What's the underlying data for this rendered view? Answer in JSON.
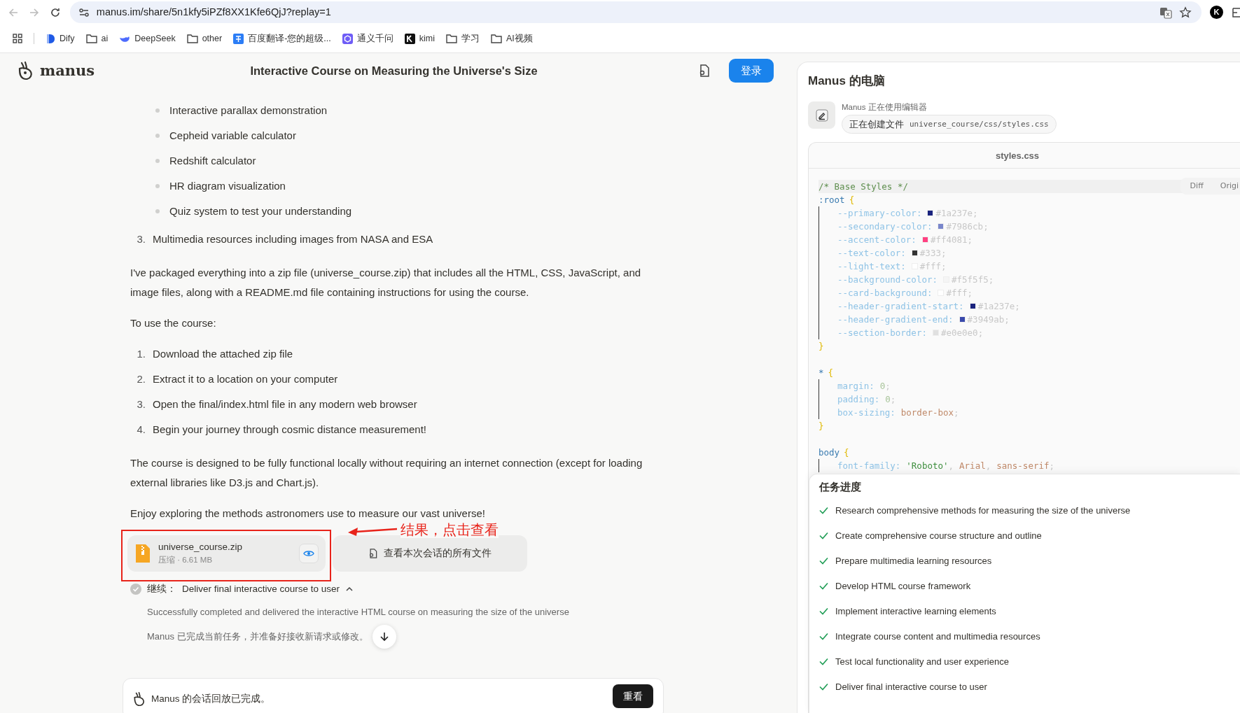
{
  "browser": {
    "url": "manus.im/share/5n1kfy5iPZf8XX1Kfe6QjJ?replay=1",
    "profile": "K",
    "bookmarks": [
      {
        "kind": "dify",
        "label": "Dify"
      },
      {
        "kind": "folder",
        "label": "ai"
      },
      {
        "kind": "deepseek",
        "label": "DeepSeek"
      },
      {
        "kind": "folder",
        "label": "other"
      },
      {
        "kind": "translate",
        "label": "百度翻译-您的超级..."
      },
      {
        "kind": "tongyi",
        "label": "通义千问"
      },
      {
        "kind": "kimi",
        "label": "kimi"
      },
      {
        "kind": "folder",
        "label": "学习"
      },
      {
        "kind": "folder",
        "label": "AI视频"
      }
    ]
  },
  "header": {
    "logo": "manus",
    "title": "Interactive Course on Measuring the Universe's Size",
    "login_button": "登录"
  },
  "content": [
    {
      "kind": "bullets",
      "items": [
        "Interactive parallax demonstration",
        "Cepheid variable calculator",
        "Redshift calculator",
        "HR diagram visualization",
        "Quiz system to test your understanding"
      ]
    },
    {
      "kind": "numbered",
      "items": [
        {
          "number": "3.",
          "text": "Multimedia resources including images from NASA and ESA"
        }
      ]
    },
    {
      "kind": "paragraph",
      "text": "I've packaged everything into a zip file (universe_course.zip) that includes all the HTML, CSS, JavaScript, and image files, along with a README.md file containing instructions for using the course."
    },
    {
      "kind": "paragraph",
      "text": "To use the course:"
    },
    {
      "kind": "numbered",
      "items": [
        {
          "number": "1.",
          "text": "Download the attached zip file"
        },
        {
          "number": "2.",
          "text": "Extract it to a location on your computer"
        },
        {
          "number": "3.",
          "text": "Open the final/index.html file in any modern web browser"
        },
        {
          "number": "4.",
          "text": "Begin your journey through cosmic distance measurement!"
        }
      ]
    },
    {
      "kind": "paragraph",
      "text": "The course is designed to be fully functional locally without requiring an internet connection (except for loading external libraries like D3.js and Chart.js)."
    },
    {
      "kind": "paragraph",
      "text": "Enjoy exploring the methods astronomers use to measure our vast universe!"
    }
  ],
  "attachment": {
    "name": "universe_course.zip",
    "meta": "压缩 · 6.61 MB",
    "all_files_button": "查看本次会话的所有文件"
  },
  "annotation": {
    "text": "结果，点击查看"
  },
  "step": {
    "label": "继续：",
    "title": "Deliver final interactive course to user",
    "expanded": true,
    "detail": "Successfully completed and delivered the interactive HTML course on measuring the size of the universe",
    "status": "Manus 已完成当前任务，并准备好接收新请求或修改。"
  },
  "replay_bar": {
    "text": "Manus 的会话回放已完成。",
    "button": "重看"
  },
  "computer": {
    "title": "Manus 的电脑",
    "activity": "Manus 正在使用编辑器",
    "action": "正在创建文件",
    "file_path": "universe_course/css/styles.css",
    "file_name": "styles.css",
    "view_tabs": [
      {
        "label": "Diff"
      },
      {
        "label": "Origi"
      }
    ],
    "code": [
      {
        "kind": "comment",
        "text": "/* Base Styles */",
        "current": true
      },
      {
        "kind": "rule",
        "selector": ":root",
        "open": "{",
        "close": "}",
        "declarations": [
          {
            "property": "--primary-color:",
            "values": [
              {
                "kind": "swatch",
                "color": "#1a237e"
              },
              {
                "kind": "hex",
                "text": "#1a237e"
              },
              {
                "kind": "punct",
                "text": ";"
              }
            ]
          },
          {
            "property": "--secondary-color:",
            "values": [
              {
                "kind": "swatch",
                "color": "#7986cb"
              },
              {
                "kind": "hex",
                "text": "#7986cb"
              },
              {
                "kind": "punct",
                "text": ";"
              }
            ]
          },
          {
            "property": "--accent-color:",
            "values": [
              {
                "kind": "swatch",
                "color": "#ff4081"
              },
              {
                "kind": "hex",
                "text": "#ff4081"
              },
              {
                "kind": "punct",
                "text": ";"
              }
            ]
          },
          {
            "property": "--text-color:",
            "values": [
              {
                "kind": "swatch",
                "color": "#333333"
              },
              {
                "kind": "hex",
                "text": "#333"
              },
              {
                "kind": "punct",
                "text": ";"
              }
            ]
          },
          {
            "property": "--light-text:",
            "values": [
              {
                "kind": "swatch",
                "color": "#ffffff"
              },
              {
                "kind": "hex",
                "text": "#fff"
              },
              {
                "kind": "punct",
                "text": ";"
              }
            ]
          },
          {
            "property": "--background-color:",
            "values": [
              {
                "kind": "swatch",
                "color": "#f5f5f5"
              },
              {
                "kind": "hex",
                "text": "#f5f5f5"
              },
              {
                "kind": "punct",
                "text": ";"
              }
            ]
          },
          {
            "property": "--card-background:",
            "values": [
              {
                "kind": "swatch",
                "color": "#ffffff"
              },
              {
                "kind": "hex",
                "text": "#fff"
              },
              {
                "kind": "punct",
                "text": ";"
              }
            ]
          },
          {
            "property": "--header-gradient-start:",
            "values": [
              {
                "kind": "swatch",
                "color": "#1a237e"
              },
              {
                "kind": "hex",
                "text": "#1a237e"
              },
              {
                "kind": "punct",
                "text": ";"
              }
            ]
          },
          {
            "property": "--header-gradient-end:",
            "values": [
              {
                "kind": "swatch",
                "color": "#3949ab"
              },
              {
                "kind": "hex",
                "text": "#3949ab"
              },
              {
                "kind": "punct",
                "text": ";"
              }
            ]
          },
          {
            "property": "--section-border:",
            "values": [
              {
                "kind": "swatch",
                "color": "#e0e0e0"
              },
              {
                "kind": "hex",
                "text": "#e0e0e0"
              },
              {
                "kind": "punct",
                "text": ";"
              }
            ]
          }
        ]
      },
      {
        "kind": "rule",
        "selector": "*",
        "open": "{",
        "close": "}",
        "declarations": [
          {
            "property": "margin:",
            "values": [
              {
                "kind": "number",
                "text": "0"
              },
              {
                "kind": "punct",
                "text": ";"
              }
            ]
          },
          {
            "property": "padding:",
            "values": [
              {
                "kind": "number",
                "text": "0"
              },
              {
                "kind": "punct",
                "text": ";"
              }
            ]
          },
          {
            "property": "box-sizing:",
            "values": [
              {
                "kind": "keyword",
                "text": "border-box"
              },
              {
                "kind": "punct",
                "text": ";"
              }
            ]
          }
        ]
      },
      {
        "kind": "rule",
        "selector": "body",
        "open": "{",
        "declarations": [
          {
            "property": "font-family:",
            "values": [
              {
                "kind": "string",
                "text": "'Roboto'"
              },
              {
                "kind": "punct",
                "text": ","
              },
              {
                "kind": "keyword",
                "text": "Arial"
              },
              {
                "kind": "punct",
                "text": ","
              },
              {
                "kind": "keyword",
                "text": "sans-serif"
              },
              {
                "kind": "punct",
                "text": ";"
              }
            ]
          }
        ]
      }
    ],
    "progress": {
      "title": "任务进度",
      "tasks": [
        {
          "text": "Research comprehensive methods for measuring the size of the universe",
          "done": true
        },
        {
          "text": "Create comprehensive course structure and outline",
          "done": true
        },
        {
          "text": "Prepare multimedia learning resources",
          "done": true
        },
        {
          "text": "Develop HTML course framework",
          "done": true
        },
        {
          "text": "Implement interactive learning elements",
          "done": true
        },
        {
          "text": "Integrate course content and multimedia resources",
          "done": true
        },
        {
          "text": "Test local functionality and user experience",
          "done": true
        },
        {
          "text": "Deliver final interactive course to user",
          "done": true
        }
      ]
    }
  }
}
